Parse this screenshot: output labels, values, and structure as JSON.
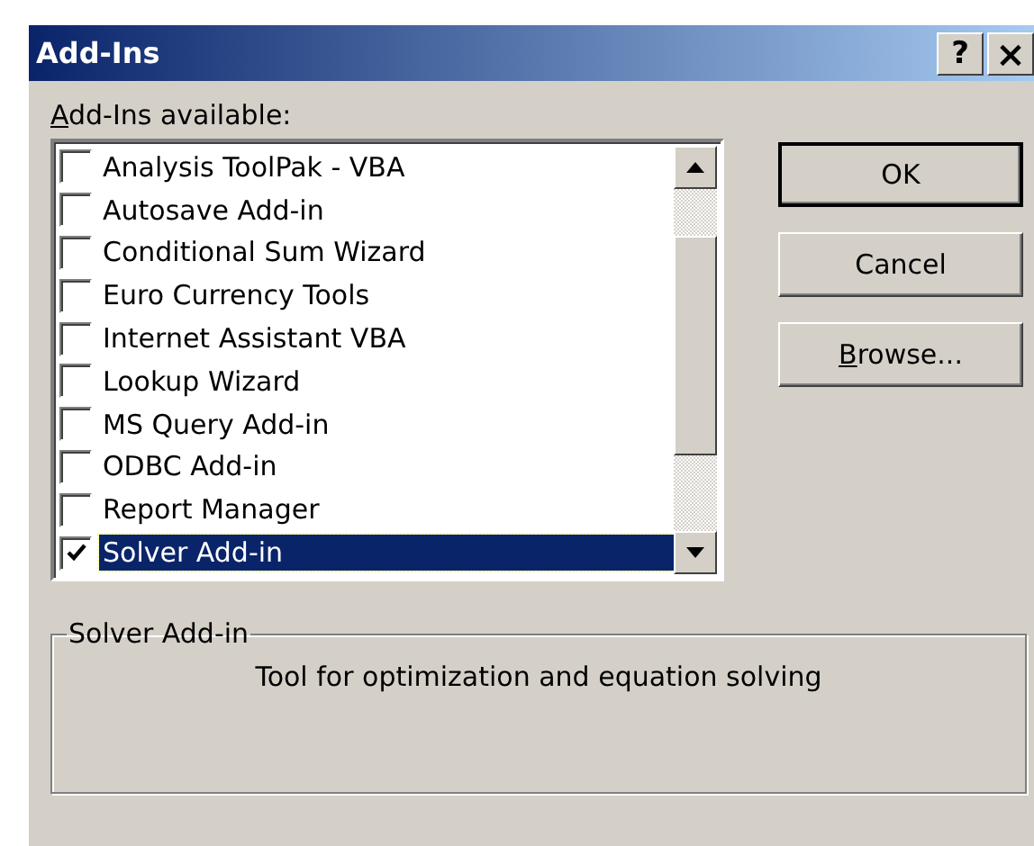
{
  "window": {
    "title": "Add-Ins",
    "title_buttons": [
      {
        "kind": "help",
        "label": "?"
      },
      {
        "kind": "close",
        "label": "×"
      }
    ]
  },
  "list_label": {
    "text": "Add-Ins available:",
    "access_key_underlined": true
  },
  "addins": [
    {
      "name": "Analysis ToolPak - VBA",
      "checked": false,
      "selected": false
    },
    {
      "name": "Autosave Add-in",
      "checked": false,
      "selected": false
    },
    {
      "name": "Conditional Sum Wizard",
      "checked": false,
      "selected": false
    },
    {
      "name": "Euro Currency Tools",
      "checked": false,
      "selected": false
    },
    {
      "name": "Internet Assistant VBA",
      "checked": false,
      "selected": false
    },
    {
      "name": "Lookup Wizard",
      "checked": false,
      "selected": false
    },
    {
      "name": "MS Query Add-in",
      "checked": false,
      "selected": false
    },
    {
      "name": "ODBC Add-in",
      "checked": false,
      "selected": false
    },
    {
      "name": "Report Manager",
      "checked": false,
      "selected": false
    },
    {
      "name": "Solver Add-in",
      "checked": true,
      "selected": true
    }
  ],
  "buttons": [
    {
      "label": "OK",
      "default": true,
      "access_key_underlined": false
    },
    {
      "label": "Cancel",
      "default": false,
      "access_key_underlined": false
    },
    {
      "label": "Browse...",
      "default": false,
      "access_key_underlined": true
    }
  ],
  "details": {
    "title": "Solver Add-in",
    "description": "Tool for optimization and equation solving"
  }
}
